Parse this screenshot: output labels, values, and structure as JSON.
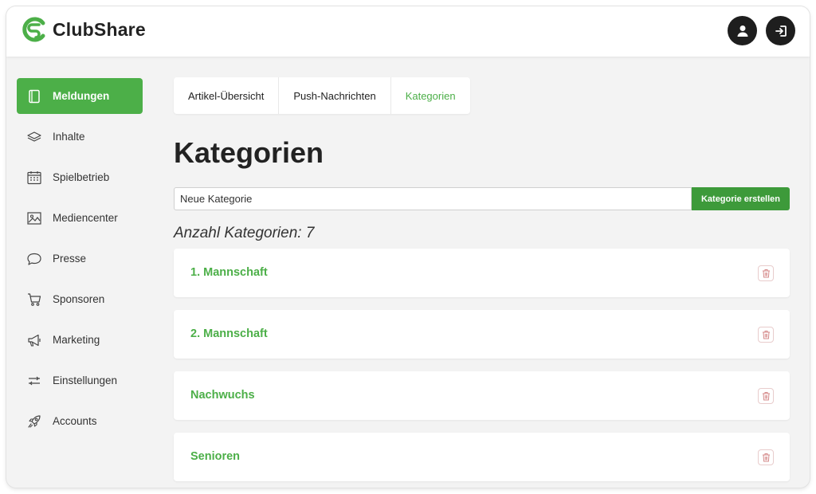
{
  "app": {
    "name": "ClubShare",
    "colors": {
      "brand": "#4caf48",
      "brand_dark": "#3d9a3a",
      "header_button": "#1e1e1e"
    }
  },
  "header": {
    "profile_icon": "user-icon",
    "logout_icon": "logout-icon"
  },
  "sidebar": {
    "items": [
      {
        "label": "Meldungen",
        "icon": "book-icon",
        "active": true
      },
      {
        "label": "Inhalte",
        "icon": "layers-icon"
      },
      {
        "label": "Spielbetrieb",
        "icon": "calendar-icon"
      },
      {
        "label": "Mediencenter",
        "icon": "image-icon"
      },
      {
        "label": "Presse",
        "icon": "chat-bubble-icon"
      },
      {
        "label": "Sponsoren",
        "icon": "cart-icon"
      },
      {
        "label": "Marketing",
        "icon": "megaphone-icon"
      },
      {
        "label": "Einstellungen",
        "icon": "sliders-icon"
      },
      {
        "label": "Accounts",
        "icon": "rocket-icon"
      }
    ]
  },
  "tabs": [
    {
      "label": "Artikel-Übersicht"
    },
    {
      "label": "Push-Nachrichten"
    },
    {
      "label": "Kategorien",
      "active": true
    }
  ],
  "main": {
    "title": "Kategorien",
    "new_category": {
      "value": "Neue Kategorie",
      "button_label": "Kategorie erstellen"
    },
    "count_label": "Anzahl Kategorien: 7",
    "categories": [
      {
        "name": "1. Mannschaft"
      },
      {
        "name": "2. Mannschaft"
      },
      {
        "name": "Nachwuchs"
      },
      {
        "name": "Senioren"
      }
    ],
    "delete_icon": "trash-icon"
  }
}
